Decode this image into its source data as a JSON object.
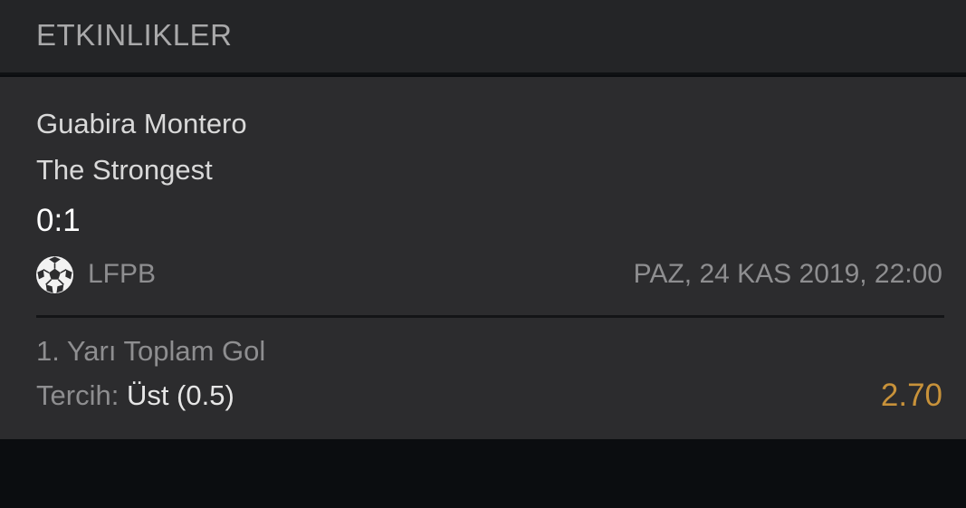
{
  "header": {
    "title": "ETKINLIKLER"
  },
  "event": {
    "home_team": "Guabira Montero",
    "away_team": "The Strongest",
    "score": "0:1",
    "sport_icon": "soccer-ball-icon",
    "league": "LFPB",
    "datetime": "PAZ, 24 KAS 2019, 22:00",
    "market": "1. Yarı Toplam Gol",
    "choice_label": "Tercih:",
    "choice_value": "Üst (0.5)",
    "odds": "2.70"
  },
  "colors": {
    "odds": "#c8923a",
    "card_background": "#2c2c2e",
    "header_background": "#242527",
    "page_background": "#0b0d10"
  }
}
